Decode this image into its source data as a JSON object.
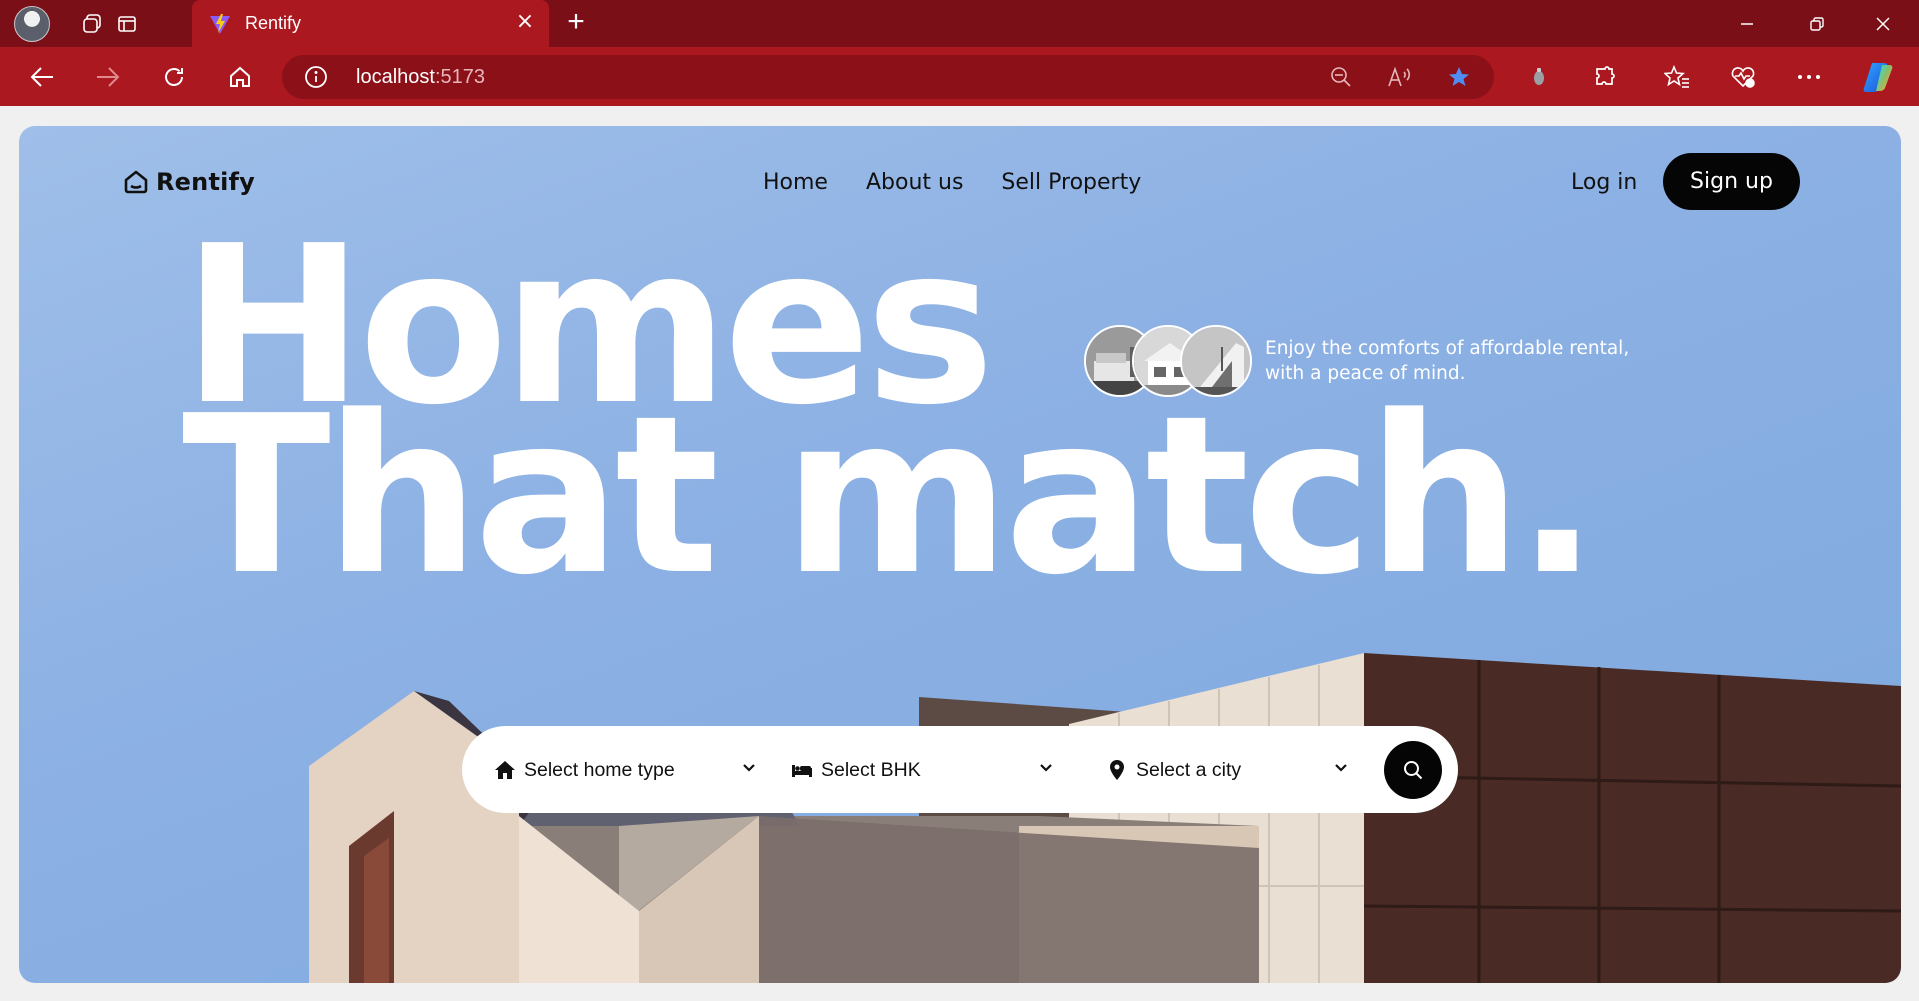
{
  "browser": {
    "tab_title": "Rentify",
    "close_tab_glyph": "×",
    "new_tab_glyph": "+",
    "address_host": "localhost",
    "address_port": ":5173",
    "accent": "#ab1820"
  },
  "nav": {
    "logo": "Rentify",
    "links": [
      "Home",
      "About us",
      "Sell Property"
    ],
    "login": "Log in",
    "signup": "Sign up"
  },
  "hero": {
    "headline_line1": "Homes",
    "headline_line2": "That match.",
    "tagline_line1": "Enjoy the comforts of affordable rental,",
    "tagline_line2": "with a peace of mind.",
    "sky_color": "#8db1e4"
  },
  "search": {
    "home_type": "Select home type",
    "bhk": "Select BHK",
    "city": "Select a city"
  }
}
